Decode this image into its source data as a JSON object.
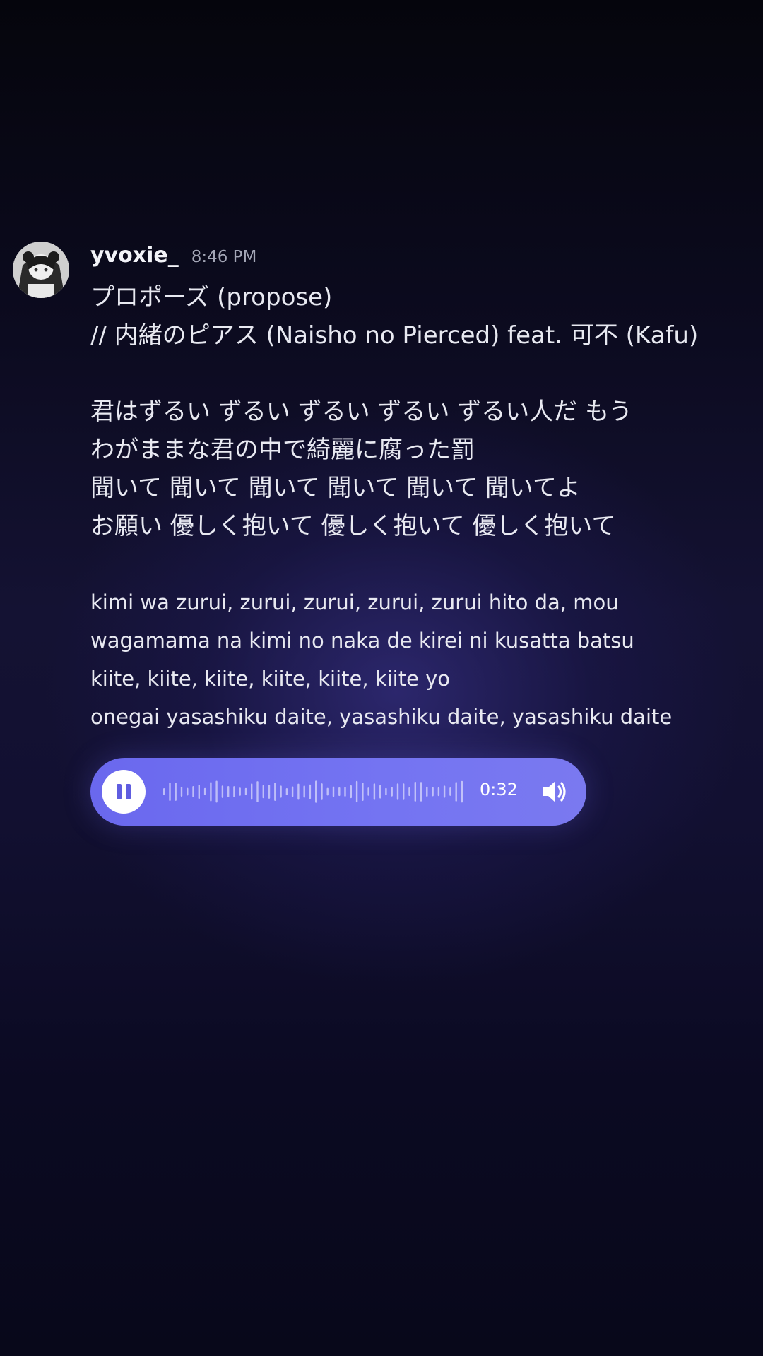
{
  "message": {
    "username": "yvoxie_",
    "timestamp": "8:46 PM",
    "title_lines": [
      "プロポーズ (propose)",
      "// 内緒のピアス (Naisho no Pierced) feat. 可不 (Kafu)"
    ],
    "japanese_lines": [
      "君はずるい ずるい ずるい ずるい ずるい人だ もう",
      "わがままな君の中で綺麗に腐った罰",
      "聞いて 聞いて 聞いて 聞いて 聞いて 聞いてよ",
      "お願い 優しく抱いて 優しく抱いて 優しく抱いて"
    ],
    "romaji_lines": [
      "kimi wa zurui, zurui, zurui, zurui, zurui hito da, mou",
      "wagamama na kimi no naka de kirei ni kusatta batsu",
      "kiite, kiite, kiite, kiite, kiite, kiite yo",
      "onegai yasashiku daite, yasashiku daite, yasashiku daite"
    ]
  },
  "audio_player": {
    "state": "playing",
    "play_icon": "pause-icon",
    "duration": "0:32",
    "volume_icon": "speaker-icon",
    "accent_color": "#6f6ef0"
  }
}
